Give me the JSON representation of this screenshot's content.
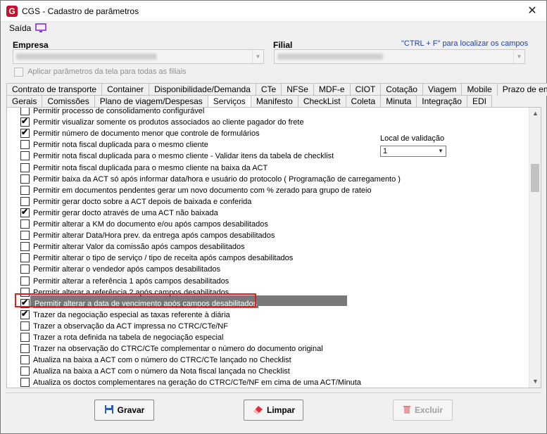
{
  "window": {
    "title": "CGS - Cadastro de parâmetros",
    "close": "✕"
  },
  "menu": {
    "saida": "Saída"
  },
  "empresa": {
    "label": "Empresa"
  },
  "filial": {
    "label": "Filial"
  },
  "hint": "\"CTRL + F\" para localizar os campos",
  "apply_all": {
    "label": "Aplicar parâmetros da tela para todas as filiais",
    "checked": false
  },
  "tabs_row1": [
    "Contrato de transporte",
    "Container",
    "Disponibilidade/Demanda",
    "CTe",
    "NFSe",
    "MDF-e",
    "CIOT",
    "Cotação",
    "Viagem",
    "Mobile",
    "Prazo de entrega"
  ],
  "tabs_row2": [
    "Gerais",
    "Comissões",
    "Plano de viagem/Despesas",
    "Serviços",
    "Manifesto",
    "CheckList",
    "Coleta",
    "Minuta",
    "Integração",
    "EDI"
  ],
  "active_tab": "Serviços",
  "local_validacao": {
    "label": "Local de validação",
    "value": "1"
  },
  "items": [
    {
      "label": "Permitir processo de consolidamento configurável",
      "checked": false
    },
    {
      "label": "Permitir visualizar somente os produtos associados ao cliente pagador do frete",
      "checked": true
    },
    {
      "label": "Permitir número de documento menor que controle de formulários",
      "checked": true
    },
    {
      "label": "Permitir nota fiscal duplicada para o mesmo cliente",
      "checked": false
    },
    {
      "label": "Permitir nota fiscal duplicada para o mesmo cliente - Validar itens da tabela de checklist",
      "checked": false
    },
    {
      "label": "Permitir nota fiscal duplicada para o mesmo cliente na baixa da ACT",
      "checked": false
    },
    {
      "label": "Permitir baixa da ACT só após informar data/hora e usuário do protocolo ( Programação de carregamento )",
      "checked": false
    },
    {
      "label": "Permitir em documentos pendentes gerar um novo documento com % zerado para grupo de rateio",
      "checked": false
    },
    {
      "label": "Permitir gerar docto sobre a ACT depois de baixada e conferida",
      "checked": false
    },
    {
      "label": "Permitir gerar docto através de uma ACT não baixada",
      "checked": true
    },
    {
      "label": "Permitir alterar a KM do documento e/ou após campos desabilitados",
      "checked": false
    },
    {
      "label": "Permitir alterar Data/Hora prev. da entrega após campos desabilitados",
      "checked": false
    },
    {
      "label": "Permitir alterar Valor da comissão após campos desabilitados",
      "checked": false
    },
    {
      "label": "Permitir alterar o tipo de serviço / tipo de receita após campos desabilitados",
      "checked": false
    },
    {
      "label": "Permitir alterar o vendedor após campos desabilitados",
      "checked": false
    },
    {
      "label": "Permitir alterar a referência 1 após campos desabilitados",
      "checked": false
    },
    {
      "label": "Permitir alterar a referência 2 após campos desabilitados",
      "checked": false
    },
    {
      "label": "Permitir alterar a data de vencimento após campos desabilitados",
      "checked": true
    },
    {
      "label": "Trazer da negociação especial as taxas referente à diária",
      "checked": true
    },
    {
      "label": "Trazer a observação da ACT impressa no CTRC/CTe/NF",
      "checked": false
    },
    {
      "label": "Trazer a rota definida na tabela de negociação especial",
      "checked": false
    },
    {
      "label": "Trazer na observação do CTRC/CTe complementar o número do documento original",
      "checked": false
    },
    {
      "label": "Atualiza na baixa a ACT com o número do CTRC/CTe lançado no Checklist",
      "checked": false
    },
    {
      "label": "Atualiza na baixa a ACT com o número da Nota fiscal lançada no Checklist",
      "checked": false
    },
    {
      "label": "Atualiza os doctos complementares na geração do CTRC/CTe/NF em cima de uma ACT/Minuta",
      "checked": false
    }
  ],
  "buttons": {
    "gravar": "Gravar",
    "limpar": "Limpar",
    "excluir": "Excluir"
  },
  "colors": {
    "accent_red": "#e51c1c",
    "selection": "#787878",
    "hint_blue": "#1a3fb5"
  }
}
